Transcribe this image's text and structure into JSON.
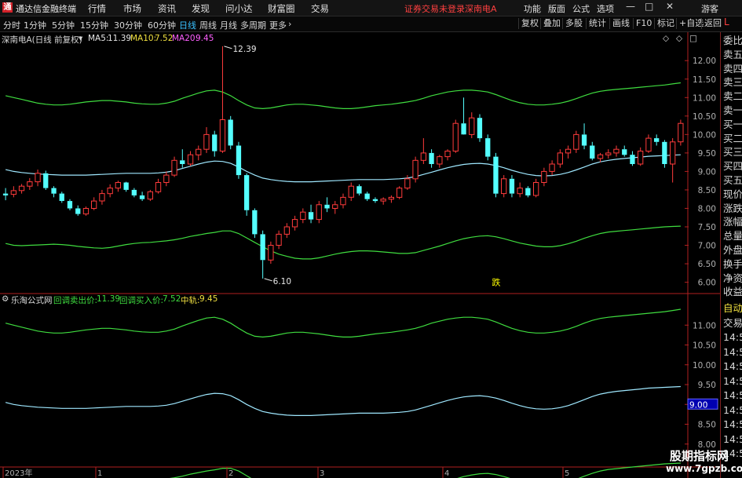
{
  "app": {
    "title": "通达信金融终端",
    "logo_letter": "L",
    "guest": "游客",
    "minimize_glyph": "—",
    "restore_glyph": "□",
    "close_glyph": "✕"
  },
  "menu": [
    "行情",
    "市场",
    "资讯",
    "发现",
    "问小达",
    "财富圈",
    "交易"
  ],
  "alert": {
    "text": "证券交易未登录",
    "stock": "深南电A"
  },
  "right_menu": [
    "功能",
    "版面",
    "公式",
    "选项"
  ],
  "periods": [
    {
      "label": "分时",
      "active": false
    },
    {
      "label": "1分钟",
      "active": false
    },
    {
      "label": "5分钟",
      "active": false
    },
    {
      "label": "15分钟",
      "active": false
    },
    {
      "label": "30分钟",
      "active": false
    },
    {
      "label": "60分钟",
      "active": false
    },
    {
      "label": "日线",
      "active": true
    },
    {
      "label": "周线",
      "active": false
    },
    {
      "label": "月线",
      "active": false
    },
    {
      "label": "多周期",
      "active": false
    },
    {
      "label": "更多",
      "active": false
    }
  ],
  "more_chevron": "›",
  "tools": [
    "复权",
    "叠加",
    "多股",
    "统计",
    "画线",
    "F10",
    "标记",
    "+自选",
    "返回"
  ],
  "main_panel": {
    "name": "深南电A(日线 前复权)",
    "ma5_label": "MA5:",
    "ma5": "11.39",
    "ma10_label": "MA10:",
    "ma10": "7.52",
    "ma20_label": "MA20:",
    "ma20": "9.45",
    "high_label": "12.39",
    "low_label": "6.10",
    "signal": "跌",
    "icons": [
      "◇",
      "◇",
      "□"
    ]
  },
  "sub_panel": {
    "name": "乐淘公式网",
    "sell_label": "回调卖出价:",
    "sell": "11.39",
    "buy_label": "回调买入价:",
    "buy": "7.52",
    "mid_label": "中轨:",
    "mid": "9.45",
    "cursor_value": "9.00"
  },
  "right_labels": [
    "委比",
    "卖五",
    "卖四",
    "卖三",
    "卖二",
    "卖一",
    "买一",
    "买二",
    "买三",
    "买四",
    "买五",
    "现价",
    "涨跌",
    "涨幅",
    "总量",
    "外盘",
    "换手",
    "净资",
    "收益"
  ],
  "right_sub_labels": [
    "自动",
    "交易",
    "14:5",
    "14:5",
    "14:5",
    "14:5",
    "14:5",
    "14:5",
    "14:5",
    "14:5",
    "14:5"
  ],
  "date_labels": [
    {
      "label": "2023年",
      "x": 6
    },
    {
      "label": "1",
      "x": 124
    },
    {
      "label": "2",
      "x": 291
    },
    {
      "label": "3",
      "x": 407
    },
    {
      "label": "4",
      "x": 566
    },
    {
      "label": "5",
      "x": 719
    }
  ],
  "watermark": {
    "cn": "股期指标网",
    "url": "www.7gpzb.com"
  },
  "colors": {
    "up": "#ff3b3b",
    "down": "#54ffff",
    "upper_band": "#3fdc3f",
    "mid_band": "#9fe8ff",
    "lower_band": "#3fdc3f",
    "signal": "#ffff00"
  },
  "chart_data": [
    {
      "type": "candlestick",
      "title": "深南电A(日线 前复权)",
      "ylim": [
        5.8,
        12.6
      ],
      "y_ticks": [
        6.0,
        6.5,
        7.0,
        7.5,
        8.0,
        8.5,
        9.0,
        9.5,
        10.0,
        10.5,
        11.0,
        11.5,
        12.0
      ],
      "ohlc": [
        [
          8.4,
          8.55,
          8.22,
          8.35
        ],
        [
          8.38,
          8.6,
          8.3,
          8.48
        ],
        [
          8.48,
          8.66,
          8.4,
          8.6
        ],
        [
          8.6,
          8.82,
          8.5,
          8.72
        ],
        [
          8.72,
          9.05,
          8.6,
          8.95
        ],
        [
          8.95,
          9.02,
          8.5,
          8.55
        ],
        [
          8.55,
          8.6,
          8.3,
          8.4
        ],
        [
          8.4,
          8.45,
          8.15,
          8.2
        ],
        [
          8.2,
          8.25,
          7.95,
          8.0
        ],
        [
          8.0,
          8.08,
          7.8,
          7.85
        ],
        [
          7.85,
          8.05,
          7.8,
          8.0
        ],
        [
          8.0,
          8.3,
          7.95,
          8.2
        ],
        [
          8.2,
          8.5,
          8.1,
          8.4
        ],
        [
          8.4,
          8.65,
          8.3,
          8.55
        ],
        [
          8.55,
          8.75,
          8.45,
          8.7
        ],
        [
          8.7,
          8.72,
          8.45,
          8.5
        ],
        [
          8.5,
          8.55,
          8.3,
          8.35
        ],
        [
          8.35,
          8.45,
          8.2,
          8.25
        ],
        [
          8.25,
          8.5,
          8.2,
          8.45
        ],
        [
          8.45,
          8.8,
          8.4,
          8.7
        ],
        [
          8.7,
          9.0,
          8.6,
          8.9
        ],
        [
          8.9,
          9.4,
          8.85,
          9.3
        ],
        [
          9.3,
          9.6,
          9.1,
          9.2
        ],
        [
          9.2,
          9.55,
          9.15,
          9.45
        ],
        [
          9.45,
          9.7,
          9.3,
          9.6
        ],
        [
          9.6,
          10.2,
          9.5,
          10.0
        ],
        [
          10.0,
          10.1,
          9.4,
          9.55
        ],
        [
          9.55,
          12.39,
          9.5,
          10.4
        ],
        [
          10.4,
          10.5,
          9.6,
          9.7
        ],
        [
          9.7,
          9.8,
          8.8,
          8.9
        ],
        [
          8.9,
          8.95,
          7.8,
          7.95
        ],
        [
          7.95,
          8.0,
          7.2,
          7.3
        ],
        [
          7.3,
          7.4,
          6.1,
          6.6
        ],
        [
          6.6,
          7.1,
          6.5,
          7.0
        ],
        [
          7.0,
          7.4,
          6.9,
          7.3
        ],
        [
          7.3,
          7.6,
          7.2,
          7.5
        ],
        [
          7.5,
          7.8,
          7.4,
          7.7
        ],
        [
          7.7,
          8.0,
          7.6,
          7.9
        ],
        [
          7.9,
          8.1,
          7.6,
          7.7
        ],
        [
          7.7,
          8.2,
          7.6,
          8.1
        ],
        [
          8.1,
          8.3,
          7.9,
          8.0
        ],
        [
          8.0,
          8.2,
          7.85,
          8.1
        ],
        [
          8.1,
          8.4,
          8.0,
          8.3
        ],
        [
          8.3,
          8.7,
          8.2,
          8.6
        ],
        [
          8.6,
          8.65,
          8.35,
          8.4
        ],
        [
          8.4,
          8.45,
          8.2,
          8.25
        ],
        [
          8.25,
          8.3,
          8.15,
          8.2
        ],
        [
          8.2,
          8.3,
          8.1,
          8.25
        ],
        [
          8.25,
          8.35,
          8.15,
          8.3
        ],
        [
          8.3,
          8.6,
          8.25,
          8.55
        ],
        [
          8.55,
          8.9,
          8.5,
          8.8
        ],
        [
          8.8,
          9.4,
          8.7,
          9.3
        ],
        [
          9.3,
          9.9,
          9.2,
          9.5
        ],
        [
          9.5,
          9.6,
          9.1,
          9.2
        ],
        [
          9.2,
          9.45,
          9.1,
          9.4
        ],
        [
          9.4,
          9.6,
          9.3,
          9.55
        ],
        [
          9.55,
          10.4,
          9.5,
          10.3
        ],
        [
          10.3,
          11.0,
          10.2,
          10.0
        ],
        [
          10.0,
          10.6,
          9.9,
          10.45
        ],
        [
          10.45,
          10.55,
          9.8,
          9.9
        ],
        [
          9.9,
          10.0,
          9.3,
          9.4
        ],
        [
          9.4,
          9.5,
          8.3,
          8.4
        ],
        [
          8.4,
          8.9,
          8.3,
          8.8
        ],
        [
          8.8,
          8.9,
          8.3,
          8.4
        ],
        [
          8.4,
          8.7,
          8.3,
          8.55
        ],
        [
          8.55,
          8.6,
          8.3,
          8.35
        ],
        [
          8.35,
          8.8,
          8.3,
          8.7
        ],
        [
          8.7,
          9.1,
          8.6,
          9.0
        ],
        [
          9.0,
          9.3,
          8.9,
          9.2
        ],
        [
          9.2,
          9.6,
          9.1,
          9.5
        ],
        [
          9.5,
          9.7,
          9.35,
          9.6
        ],
        [
          9.6,
          10.1,
          9.5,
          10.0
        ],
        [
          10.0,
          10.3,
          9.6,
          9.7
        ],
        [
          9.7,
          9.8,
          9.3,
          9.35
        ],
        [
          9.35,
          9.5,
          9.25,
          9.45
        ],
        [
          9.45,
          9.6,
          9.35,
          9.5
        ],
        [
          9.5,
          9.7,
          9.4,
          9.6
        ],
        [
          9.6,
          9.7,
          9.4,
          9.45
        ],
        [
          9.45,
          9.55,
          9.15,
          9.2
        ],
        [
          9.2,
          9.65,
          9.15,
          9.55
        ],
        [
          9.55,
          10.0,
          9.5,
          9.9
        ],
        [
          9.9,
          10.0,
          9.7,
          9.8
        ],
        [
          9.8,
          9.85,
          9.1,
          9.2
        ],
        [
          9.2,
          9.9,
          8.7,
          9.8
        ],
        [
          9.8,
          10.4,
          9.7,
          10.3
        ]
      ],
      "bands": {
        "upper": [
          11.05,
          11.0,
          10.95,
          10.9,
          10.85,
          10.82,
          10.8,
          10.8,
          10.82,
          10.85,
          10.88,
          10.9,
          10.92,
          10.92,
          10.9,
          10.88,
          10.85,
          10.83,
          10.82,
          10.82,
          10.85,
          10.9,
          10.98,
          11.05,
          11.12,
          11.18,
          11.2,
          11.15,
          11.05,
          10.92,
          10.8,
          10.72,
          10.7,
          10.72,
          10.76,
          10.8,
          10.82,
          10.82,
          10.8,
          10.78,
          10.75,
          10.72,
          10.7,
          10.7,
          10.72,
          10.75,
          10.78,
          10.8,
          10.82,
          10.85,
          10.88,
          10.92,
          10.98,
          11.05,
          11.1,
          11.15,
          11.18,
          11.2,
          11.2,
          11.18,
          11.15,
          11.08,
          11.0,
          10.92,
          10.86,
          10.82,
          10.8,
          10.8,
          10.82,
          10.85,
          10.9,
          10.97,
          11.05,
          11.12,
          11.17,
          11.2,
          11.22,
          11.24,
          11.26,
          11.28,
          11.3,
          11.32,
          11.34,
          11.37,
          11.4
        ],
        "mid": [
          9.05,
          9.0,
          8.97,
          8.95,
          8.93,
          8.92,
          8.91,
          8.9,
          8.9,
          8.9,
          8.9,
          8.91,
          8.92,
          8.93,
          8.94,
          8.95,
          8.95,
          8.95,
          8.95,
          8.96,
          8.98,
          9.02,
          9.08,
          9.14,
          9.2,
          9.25,
          9.28,
          9.27,
          9.22,
          9.12,
          9.0,
          8.9,
          8.82,
          8.78,
          8.75,
          8.73,
          8.72,
          8.72,
          8.72,
          8.73,
          8.74,
          8.75,
          8.76,
          8.77,
          8.78,
          8.78,
          8.78,
          8.78,
          8.79,
          8.8,
          8.82,
          8.86,
          8.92,
          8.98,
          9.04,
          9.1,
          9.15,
          9.19,
          9.21,
          9.22,
          9.2,
          9.16,
          9.1,
          9.03,
          8.97,
          8.92,
          8.89,
          8.88,
          8.89,
          8.92,
          8.97,
          9.04,
          9.12,
          9.2,
          9.26,
          9.3,
          9.33,
          9.35,
          9.37,
          9.39,
          9.41,
          9.42,
          9.43,
          9.44,
          9.45
        ],
        "lower": [
          7.05,
          7.0,
          6.99,
          7.0,
          7.01,
          7.02,
          7.03,
          7.02,
          7.0,
          6.97,
          6.95,
          6.93,
          6.92,
          6.94,
          6.98,
          7.02,
          7.05,
          7.07,
          7.08,
          7.1,
          7.12,
          7.15,
          7.19,
          7.24,
          7.28,
          7.32,
          7.35,
          7.39,
          7.39,
          7.32,
          7.2,
          7.08,
          6.96,
          6.85,
          6.76,
          6.7,
          6.65,
          6.63,
          6.63,
          6.66,
          6.71,
          6.76,
          6.8,
          6.83,
          6.85,
          6.85,
          6.84,
          6.82,
          6.8,
          6.78,
          6.78,
          6.8,
          6.86,
          6.92,
          6.98,
          7.05,
          7.12,
          7.18,
          7.22,
          7.25,
          7.26,
          7.23,
          7.18,
          7.12,
          7.06,
          7.02,
          6.98,
          6.96,
          6.96,
          6.99,
          7.04,
          7.11,
          7.19,
          7.26,
          7.32,
          7.36,
          7.38,
          7.4,
          7.42,
          7.44,
          7.46,
          7.48,
          7.5,
          7.51,
          7.52
        ]
      }
    },
    {
      "type": "line",
      "title": "乐淘公式网",
      "y_ticks": [
        8.0,
        8.5,
        9.0,
        9.5,
        10.0,
        10.5,
        11.0
      ],
      "ylim": [
        7.5,
        11.5
      ],
      "series": [
        {
          "name": "回调卖出价",
          "ref": "upper"
        },
        {
          "name": "中轨",
          "ref": "mid"
        },
        {
          "name": "回调买入价",
          "ref": "lower"
        }
      ]
    }
  ]
}
